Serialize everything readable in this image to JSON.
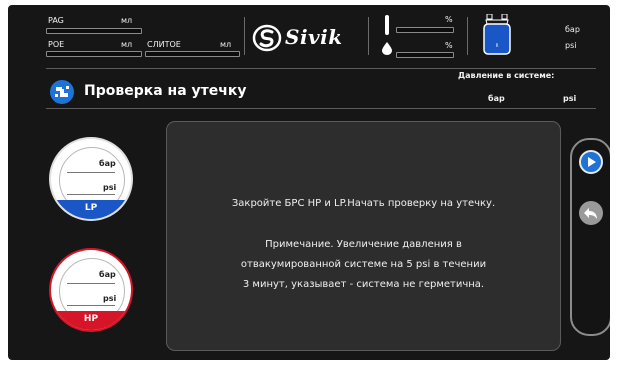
{
  "top": {
    "rag_label": "PAG",
    "rag_unit": "мл",
    "poe_label": "POE",
    "poe_unit": "мл",
    "drain_label": "СЛИТОЕ",
    "drain_unit": "мл",
    "pct_top": "%",
    "pct_bottom": "%",
    "unit_bar": "бар",
    "unit_psi": "psi"
  },
  "logo": {
    "text": "Sivik"
  },
  "header": {
    "title": "Проверка на утечку",
    "pressure_label": "Давление в системе:",
    "bar": "бар",
    "psi": "psi"
  },
  "gauges": {
    "lp": {
      "bar": "бар",
      "psi": "psi",
      "label": "LP"
    },
    "hp": {
      "bar": "бар",
      "psi": "psi",
      "label": "HP"
    }
  },
  "message": {
    "line1": "Закройте БРС HP и LP.Начать проверку на утечку.",
    "line2": "Примечание. Увеличение давления в",
    "line3": "отвакумированной системе на 5 psi  в течении",
    "line4": "3 минут, указывает -  система не герметична."
  },
  "colors": {
    "blue": "#1a56c5",
    "red": "#d71528",
    "panel": "#2d2d2d"
  },
  "icons": {
    "title": "leak-test-icon",
    "next": "play-icon",
    "back": "back-icon",
    "tank": "refrigerant-tank-icon",
    "oil": "oil-drop-icon"
  }
}
